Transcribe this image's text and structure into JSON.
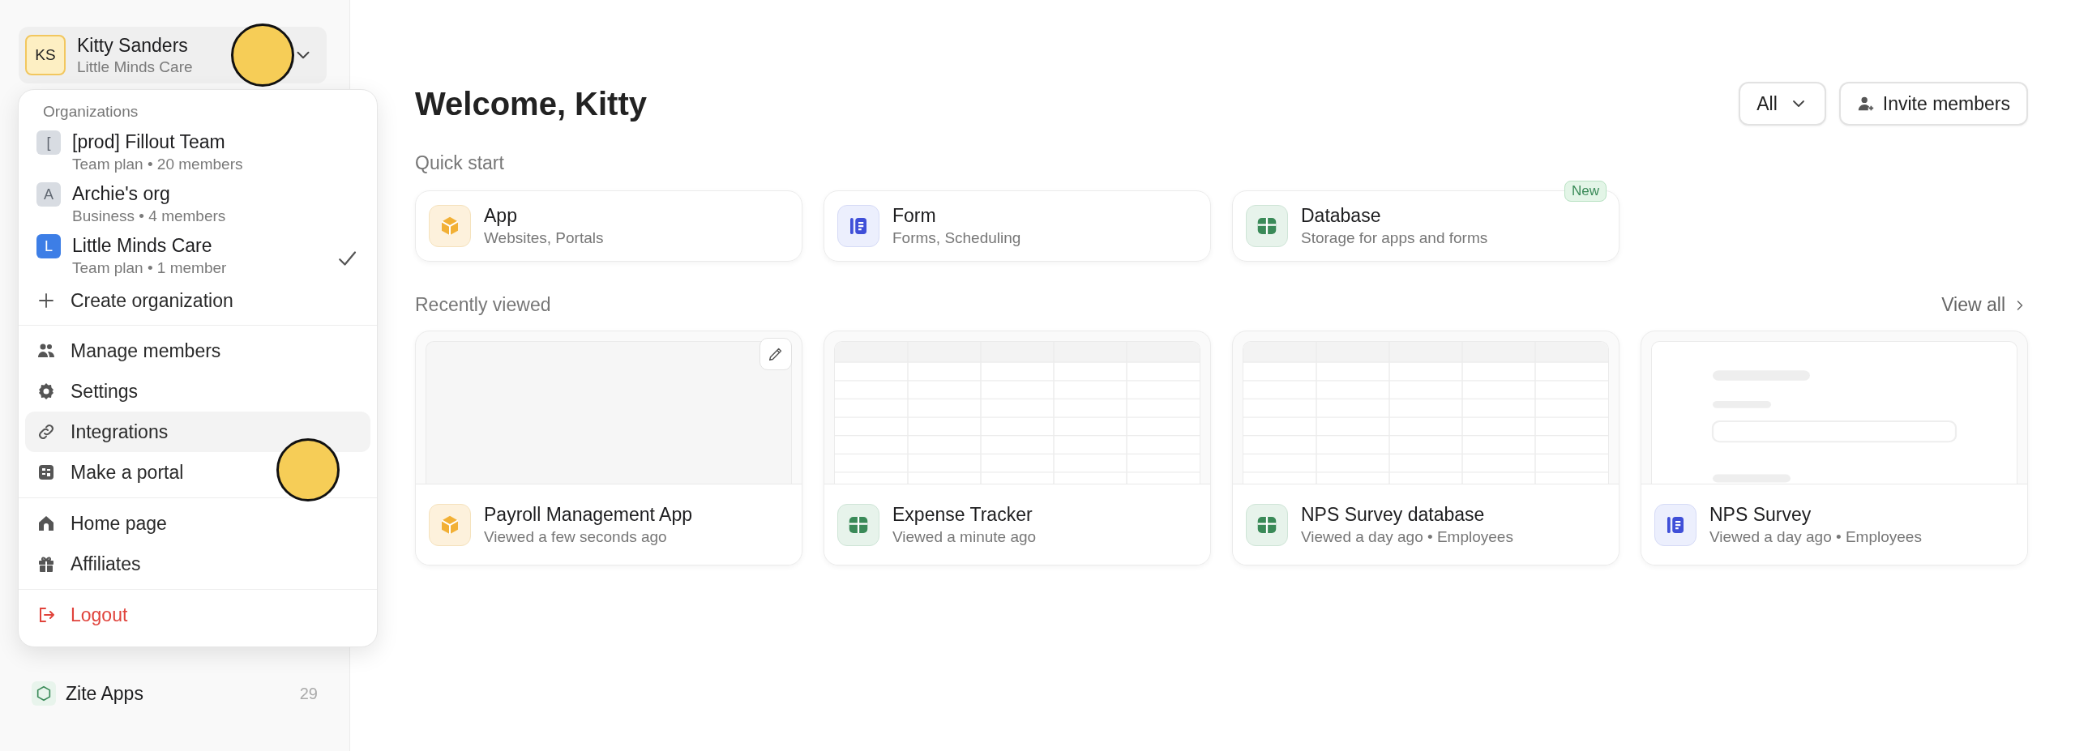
{
  "account": {
    "initials": "KS",
    "name": "Kitty Sanders",
    "org": "Little Minds Care"
  },
  "sidebar": {
    "items": [
      {
        "label": "Zite Apps",
        "count": "29"
      }
    ]
  },
  "menu": {
    "section_title": "Organizations",
    "organizations": [
      {
        "initial": "[",
        "name": "[prod] Fillout Team",
        "details": "Team plan • 20 members",
        "color": "#d8dce2",
        "selected": false
      },
      {
        "initial": "A",
        "name": "Archie's org",
        "details": "Business • 4 members",
        "color": "#d8dce2",
        "selected": false
      },
      {
        "initial": "L",
        "name": "Little Minds Care",
        "details": "Team plan • 1 member",
        "color": "#3d7ee6",
        "selected": true
      }
    ],
    "create_label": "Create organization",
    "groups": [
      [
        {
          "label": "Manage members",
          "kind": "members",
          "hovered": false
        },
        {
          "label": "Settings",
          "kind": "settings",
          "hovered": false
        },
        {
          "label": "Integrations",
          "kind": "link",
          "hovered": true
        },
        {
          "label": "Make a portal",
          "kind": "portal",
          "hovered": false
        }
      ],
      [
        {
          "label": "Home page",
          "kind": "home",
          "hovered": false
        },
        {
          "label": "Affiliates",
          "kind": "gift",
          "hovered": false
        }
      ],
      [
        {
          "label": "Logout",
          "kind": "logout",
          "hovered": false
        }
      ]
    ]
  },
  "main": {
    "title": "Welcome, Kitty",
    "filter": {
      "value": "All"
    },
    "invite_label": "Invite members",
    "quick_start": {
      "title": "Quick start",
      "items": [
        {
          "kind": "app",
          "title": "App",
          "subtitle": "Websites, Portals"
        },
        {
          "kind": "form",
          "title": "Form",
          "subtitle": "Forms, Scheduling"
        },
        {
          "kind": "database",
          "title": "Database",
          "subtitle": "Storage for apps and forms",
          "badge": "New"
        }
      ]
    },
    "recent": {
      "title": "Recently viewed",
      "view_all": "View all",
      "items": [
        {
          "kind": "app",
          "title": "Payroll Management App",
          "subtitle": "Viewed a few seconds ago",
          "hovered": true
        },
        {
          "kind": "database",
          "title": "Expense Tracker",
          "subtitle": "Viewed a minute ago",
          "hovered": false
        },
        {
          "kind": "database",
          "title": "NPS Survey database",
          "subtitle": "Viewed a day ago • Employees",
          "hovered": false
        },
        {
          "kind": "form",
          "title": "NPS Survey",
          "subtitle": "Viewed a day ago • Employees",
          "hovered": false
        }
      ]
    }
  }
}
